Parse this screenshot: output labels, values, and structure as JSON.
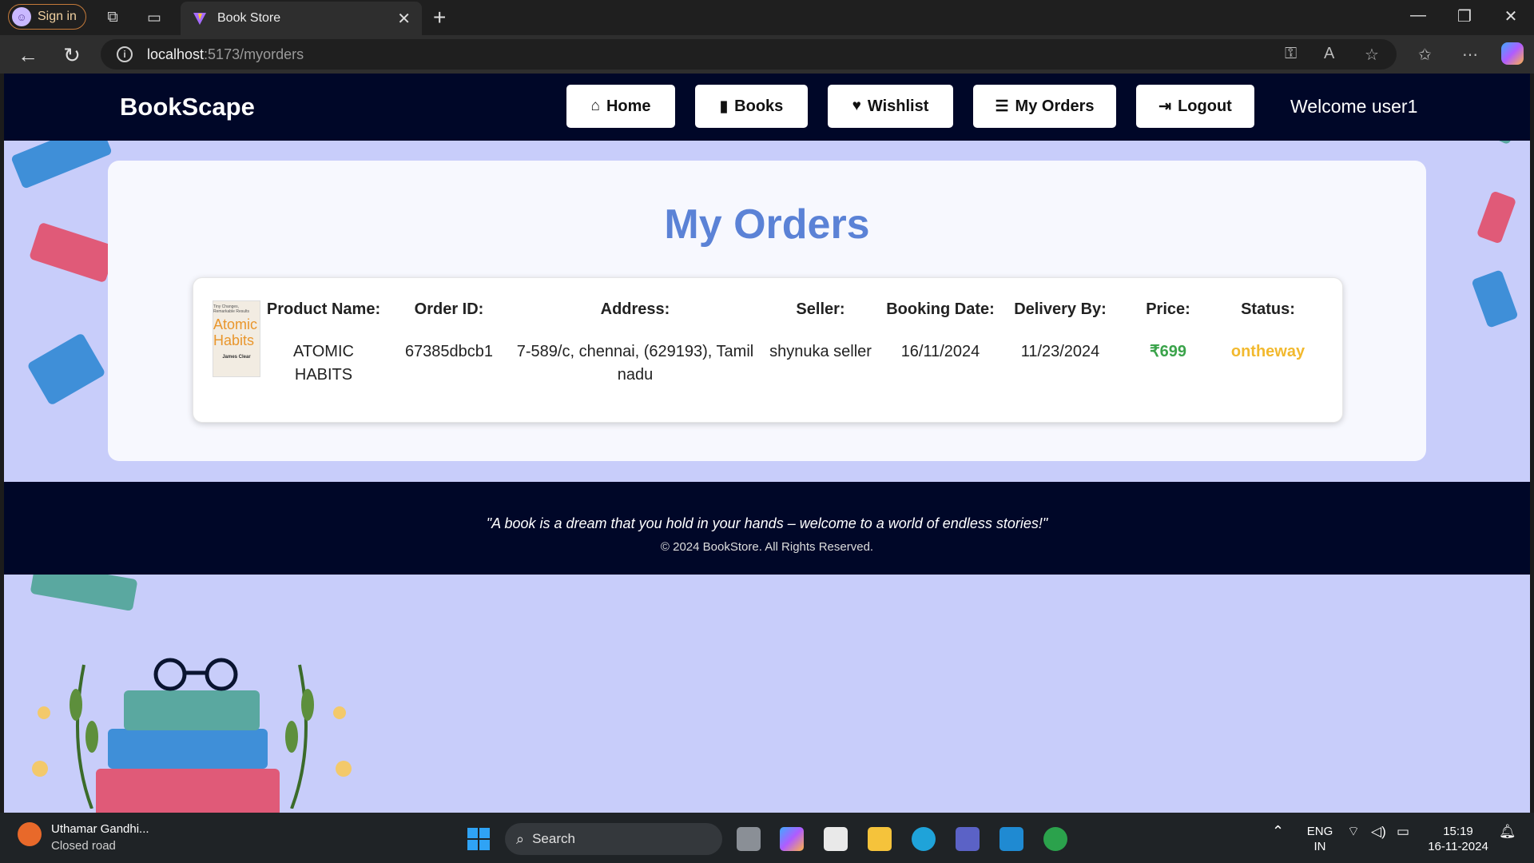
{
  "browser": {
    "signin_label": "Sign in",
    "tab_title": "Book Store",
    "url_host": "localhost",
    "url_path": ":5173/myorders"
  },
  "nav": {
    "brand": "BookScape",
    "buttons": [
      {
        "label": "Home",
        "icon": "home-icon"
      },
      {
        "label": "Books",
        "icon": "book-icon"
      },
      {
        "label": "Wishlist",
        "icon": "heart-icon"
      },
      {
        "label": "My Orders",
        "icon": "list-icon"
      },
      {
        "label": "Logout",
        "icon": "logout-icon"
      }
    ],
    "welcome": "Welcome user1"
  },
  "main": {
    "title": "My Orders",
    "headers": {
      "product": "Product Name:",
      "order_id": "Order ID:",
      "address": "Address:",
      "seller": "Seller:",
      "booking_date": "Booking Date:",
      "delivery_by": "Delivery By:",
      "price": "Price:",
      "status": "Status:"
    },
    "orders": [
      {
        "cover_title": "Atomic Habits",
        "cover_author": "James Clear",
        "cover_tagline": "Tiny Changes, Remarkable Results",
        "product": "ATOMIC HABITS",
        "order_id": "67385dbcb1",
        "address": "7-589/c, chennai, (629193), Tamil nadu",
        "seller": "shynuka seller",
        "booking_date": "16/11/2024",
        "delivery_by": "11/23/2024",
        "price": "₹699",
        "status": "ontheway"
      }
    ]
  },
  "footer": {
    "quote": "\"A book is a dream that you hold in your hands – welcome to a world of endless stories!\"",
    "copyright": "© 2024 BookStore. All Rights Reserved."
  },
  "taskbar": {
    "weather_title": "Uthamar Gandhi...",
    "weather_sub": "Closed road",
    "search_label": "Search",
    "lang_1": "ENG",
    "lang_2": "IN",
    "time": "15:19",
    "date": "16-11-2024"
  },
  "colors": {
    "nav_bg": "#000728",
    "page_bg": "#c8cdfa",
    "title": "#5b82d6",
    "price": "#3aa34a",
    "status": "#f2b92e"
  }
}
